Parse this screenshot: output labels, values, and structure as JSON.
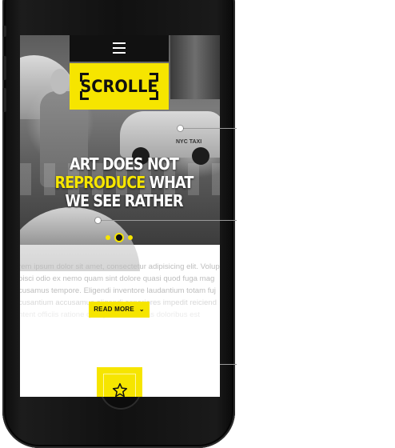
{
  "device": {
    "model": "smartphone"
  },
  "header": {
    "menu_icon": "hamburger-menu-icon",
    "logo_text": "SCROLLE"
  },
  "hero": {
    "headline_line1": "ART DOES NOT",
    "headline_highlight": "REPRODUCE",
    "headline_line2_rest": " WHAT",
    "headline_line3": "WE SEE RATHER",
    "taxi_label": "NYC TAXI",
    "slider": {
      "dots": 3,
      "active_index": 1
    }
  },
  "body": {
    "lines": [
      "rem ipsum dolor sit amet, consectetur adipisicing elit. Volup",
      "pisci odio ex nemo quam sint dolore quasi quod fuga mag",
      "cusamus tempore. Eligendi inventore laudantium totam fuj",
      "cusantium accusamus eligendi asperiores impedit reiciend",
      "ntent officiis ratione quisquam molestias doloribus est"
    ],
    "read_more_label": "READ MORE",
    "read_more_icon": "chevron-down-icon",
    "feature_icon": "star-icon"
  },
  "colors": {
    "accent": "#f6e500",
    "nav_bg": "#111111",
    "text_muted": "#bdbdbd",
    "callout_line": "#9a9a9a"
  }
}
